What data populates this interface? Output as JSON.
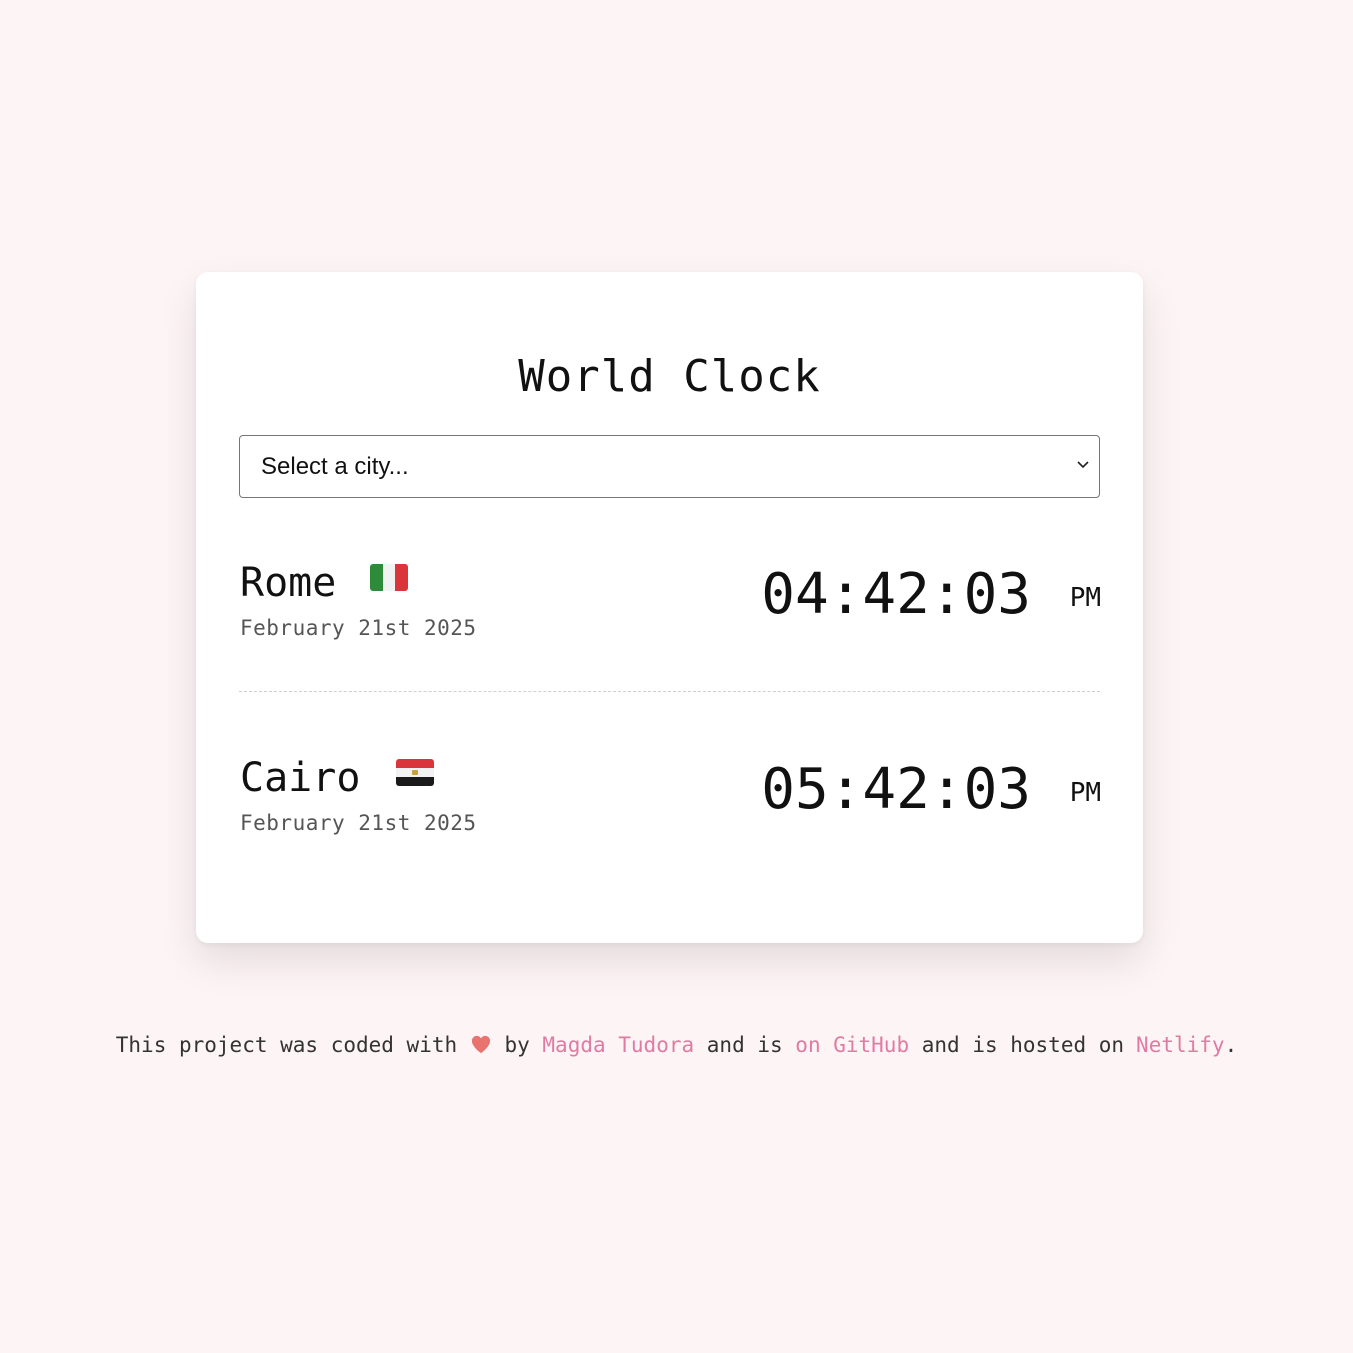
{
  "app": {
    "title": "World Clock"
  },
  "city_select": {
    "placeholder": "Select a city..."
  },
  "cities": [
    {
      "name": "Rome",
      "flag_icon": "italy-flag-icon",
      "date": "February 21st 2025",
      "time": "04:42:03",
      "ampm": "PM"
    },
    {
      "name": "Cairo",
      "flag_icon": "egypt-flag-icon",
      "date": "February 21st 2025",
      "time": "05:42:03",
      "ampm": "PM"
    }
  ],
  "footer": {
    "text1": "This project was coded with",
    "heart_icon": "heart-icon",
    "text2": "by",
    "author_link": "Magda Tudora",
    "text3": "and is",
    "github_link": "on GitHub",
    "text4": "and is hosted on",
    "netlify_link": "Netlify",
    "text5": "."
  },
  "colors": {
    "background": "#fdf4f5",
    "card": "#ffffff",
    "link": "#e07ba3",
    "heart": "#e8736f"
  }
}
